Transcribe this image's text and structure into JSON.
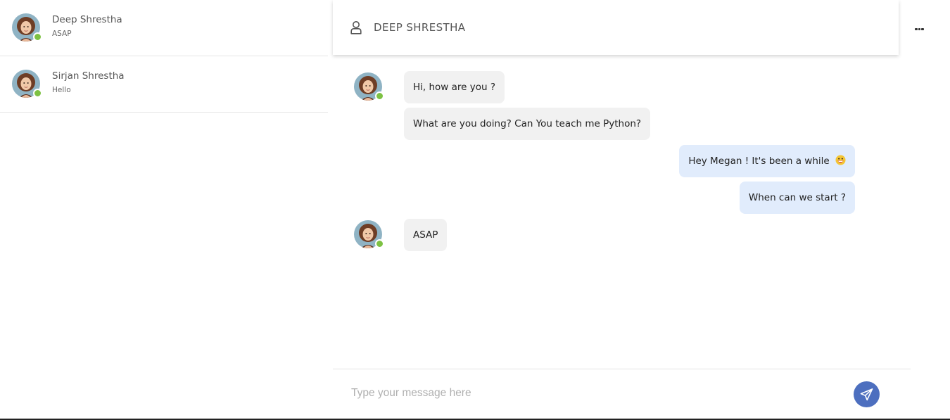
{
  "sidebar": {
    "contacts": [
      {
        "name": "Deep Shrestha",
        "preview": "ASAP",
        "status": "online"
      },
      {
        "name": "Sirjan Shrestha",
        "preview": "Hello",
        "status": "online"
      }
    ]
  },
  "chat": {
    "header_title": "DEEP SHRESTHA",
    "messages": [
      {
        "from": "them",
        "text": "Hi, how are you ?"
      },
      {
        "from": "them",
        "text": "What are you doing? Can You teach me Python?"
      },
      {
        "from": "me",
        "text": "Hey Megan ! It's been a while"
      },
      {
        "from": "me",
        "text": "When can we start ?"
      },
      {
        "from": "them",
        "text": "ASAP"
      }
    ]
  },
  "composer": {
    "placeholder": "Type your message here",
    "value": ""
  },
  "icons": {
    "header": "user-icon",
    "more": "more-options-icon",
    "send": "send-icon",
    "emoji": "grinning-face-emoji"
  },
  "colors": {
    "online": "#7dc143",
    "incoming_bubble": "#f1f1f1",
    "outgoing_bubble": "#e1ecfc",
    "send_button": "#4d6fbf"
  }
}
